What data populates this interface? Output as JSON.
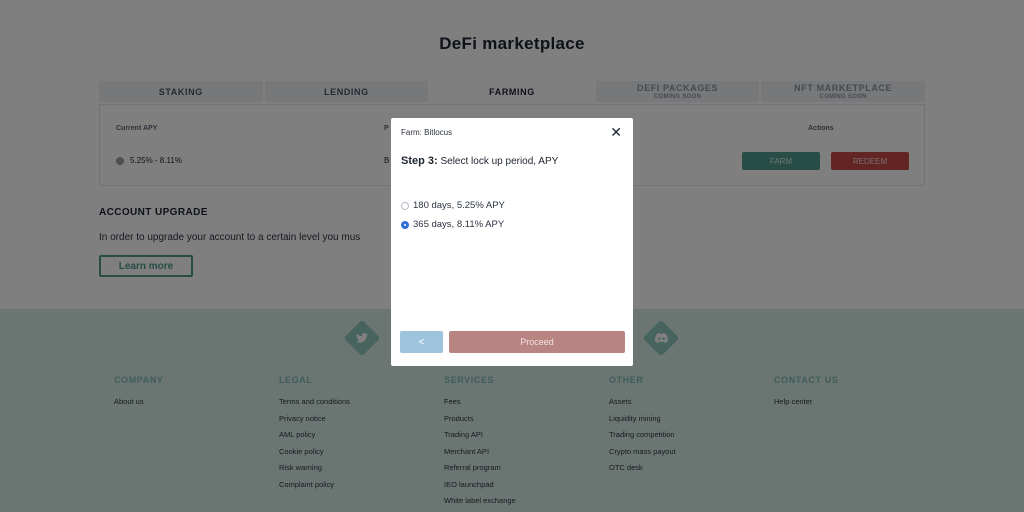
{
  "page": {
    "title": "DeFi marketplace"
  },
  "tabs": [
    {
      "label": "STAKING",
      "sub": ""
    },
    {
      "label": "LENDING",
      "sub": ""
    },
    {
      "label": "FARMING",
      "sub": ""
    },
    {
      "label": "DEFI PACKAGES",
      "sub": "Coming soon"
    },
    {
      "label": "NFT MARKETPLACE",
      "sub": "Coming soon"
    }
  ],
  "table": {
    "col_apy": "Current APY",
    "col_pair": "P",
    "col_actions": "Actions",
    "apy_value": "5.25% - 8.11%",
    "pair_value": "B",
    "farm_label": "FARM",
    "redeem_label": "REDEEM"
  },
  "upgrade": {
    "title": "ACCOUNT UPGRADE",
    "text": "In order to upgrade your account to a certain level you mus",
    "learn_more": "Learn more"
  },
  "footer": {
    "columns": [
      {
        "title": "COMPANY",
        "links": [
          "About us"
        ]
      },
      {
        "title": "LEGAL",
        "links": [
          "Terms and conditions",
          "Privacy notice",
          "AML policy",
          "Cookie policy",
          "Risk warning",
          "Complaint policy"
        ]
      },
      {
        "title": "SERVICES",
        "links": [
          "Fees",
          "Products",
          "Trading API",
          "Merchant API",
          "Referral program",
          "IEO launchpad",
          "White label exchange"
        ]
      },
      {
        "title": "OTHER",
        "links": [
          "Assets",
          "Liquidity mining",
          "Trading competition",
          "Crypto mass payout",
          "OTC desk"
        ]
      },
      {
        "title": "CONTACT US",
        "links": [
          "Help center"
        ]
      }
    ],
    "social_icons": [
      "twitter-icon",
      "discord-icon"
    ]
  },
  "modal": {
    "header": "Farm: Bitlocus",
    "close": "✕",
    "step_label": "Step 3:",
    "step_text": "Select lock up period, APY",
    "options": [
      {
        "label": "180 days, 5.25% APY",
        "selected": false
      },
      {
        "label": "365 days, 8.11% APY",
        "selected": true
      }
    ],
    "back_label": "<",
    "proceed_label": "Proceed"
  }
}
